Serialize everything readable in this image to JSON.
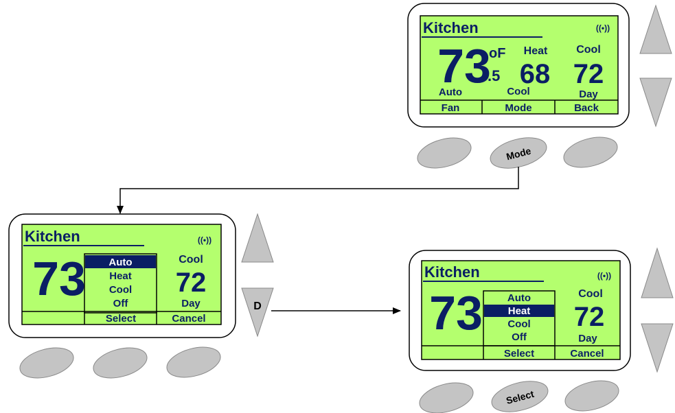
{
  "colors": {
    "lcd": "#b4ff6e",
    "ink": "#0a1e64",
    "button_fill": "#c4c4c4",
    "button_stroke": "#888888",
    "highlight_text": "#ffffff"
  },
  "thermostat_top": {
    "room": "Kitchen",
    "signal_icon": "((•))",
    "temp_whole": "73",
    "temp_unit": "oF",
    "temp_fraction": ".5",
    "heat_label": "Heat",
    "heat_value": "68",
    "cool_label": "Cool",
    "cool_value": "72",
    "fan_state": "Auto",
    "mode_state": "Cool",
    "schedule": "Day",
    "softkeys": [
      "Fan",
      "Mode",
      "Back"
    ],
    "pressed_button": "Mode"
  },
  "thermostat_left": {
    "room": "Kitchen",
    "signal_icon": "((•))",
    "temp_whole": "73",
    "menu": [
      "Auto",
      "Heat",
      "Cool",
      "Off"
    ],
    "selected_index": 0,
    "cool_label": "Cool",
    "cool_value": "72",
    "schedule": "Day",
    "softkeys": [
      "",
      "Select",
      "Cancel"
    ],
    "down_key_label": "D"
  },
  "thermostat_right": {
    "room": "Kitchen",
    "signal_icon": "((•))",
    "temp_whole": "73",
    "menu": [
      "Auto",
      "Heat",
      "Cool",
      "Off"
    ],
    "selected_index": 1,
    "cool_label": "Cool",
    "cool_value": "72",
    "schedule": "Day",
    "softkeys": [
      "",
      "Select",
      "Cancel"
    ],
    "pressed_button": "Select"
  }
}
